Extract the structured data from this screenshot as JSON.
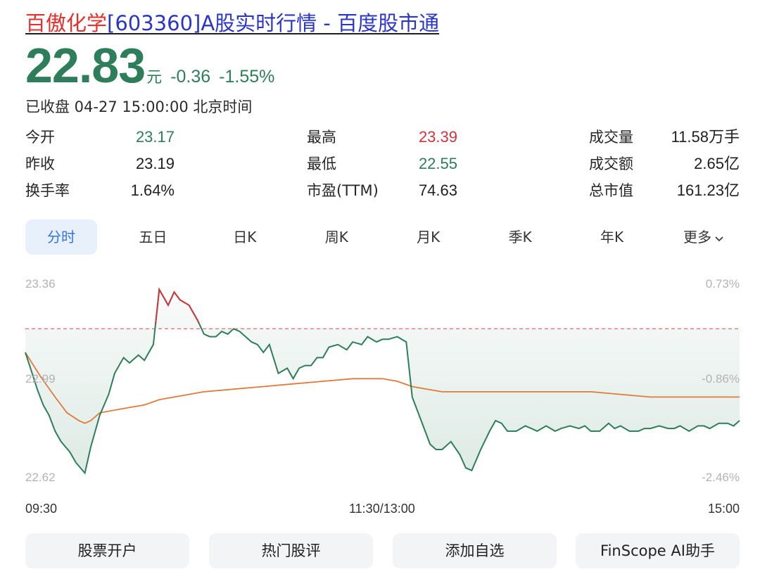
{
  "header": {
    "title_stock": "百傲化学",
    "title_rest": "[603360]A股实时行情 - 百度股市通"
  },
  "quote": {
    "price": "22.83",
    "unit": "元",
    "change": "-0.36",
    "change_pct": "-1.55%",
    "status": "已收盘 04-27 15:00:00 北京时间"
  },
  "stats": [
    {
      "label": "今开",
      "value": "23.17",
      "tone": "green"
    },
    {
      "label": "最高",
      "value": "23.39",
      "tone": "red"
    },
    {
      "label": "成交量",
      "value": "11.58万手",
      "tone": "dark"
    },
    {
      "label": "昨收",
      "value": "23.19",
      "tone": "dark"
    },
    {
      "label": "最低",
      "value": "22.55",
      "tone": "green"
    },
    {
      "label": "成交额",
      "value": "2.65亿",
      "tone": "dark"
    },
    {
      "label": "换手率",
      "value": "1.64%",
      "tone": "dark"
    },
    {
      "label": "市盈(TTM)",
      "value": "74.63",
      "tone": "dark"
    },
    {
      "label": "总市值",
      "value": "161.23亿",
      "tone": "dark"
    }
  ],
  "tabs": [
    "分时",
    "五日",
    "日K",
    "周K",
    "月K",
    "季K",
    "年K",
    "更多"
  ],
  "active_tab": 0,
  "colors": {
    "up": "#d0353f",
    "down": "#2e7d5b",
    "avg": "#e07b39",
    "ref": "#e07070"
  },
  "chart_data": {
    "type": "line",
    "y_axis_left": [
      "23.36",
      "22.99",
      "22.62"
    ],
    "y_axis_right": [
      "0.73%",
      "-0.86%",
      "-2.46%"
    ],
    "x_axis": [
      "09:30",
      "11:30/13:00",
      "15:00"
    ],
    "prev_close": 23.19,
    "ylim": [
      22.62,
      23.36
    ],
    "series": [
      {
        "key": "price",
        "x": [
          0,
          2,
          4,
          6,
          8,
          10,
          12,
          15,
          17,
          20,
          22,
          25,
          28,
          30,
          33,
          35,
          38,
          40,
          43,
          45,
          48,
          50,
          52,
          55,
          58,
          60,
          62,
          64,
          66,
          68,
          70,
          72,
          74,
          76,
          78,
          80,
          82,
          85,
          88,
          90,
          92,
          94,
          96,
          98,
          100,
          102,
          105,
          108,
          110,
          113,
          115,
          118,
          120,
          122,
          125,
          128,
          130,
          133,
          136,
          138,
          140,
          143,
          146,
          148,
          150,
          153,
          156,
          158,
          160,
          162,
          165,
          168,
          170,
          172,
          175,
          178,
          180,
          183,
          186,
          188,
          190,
          193,
          196,
          198,
          200,
          203,
          206,
          208,
          210,
          213,
          216,
          218,
          220,
          223,
          226,
          228,
          230,
          233,
          236,
          238,
          240
        ],
        "values": [
          23.1,
          23.03,
          22.96,
          22.9,
          22.86,
          22.8,
          22.76,
          22.72,
          22.68,
          22.64,
          22.74,
          22.86,
          22.94,
          23.02,
          23.08,
          23.06,
          23.09,
          23.07,
          23.13,
          23.34,
          23.28,
          23.33,
          23.3,
          23.28,
          23.22,
          23.17,
          23.16,
          23.16,
          23.18,
          23.17,
          23.19,
          23.18,
          23.16,
          23.14,
          23.13,
          23.1,
          23.13,
          23.02,
          23.04,
          23.0,
          23.04,
          23.05,
          23.05,
          23.08,
          23.08,
          23.12,
          23.13,
          23.11,
          23.14,
          23.13,
          23.16,
          23.14,
          23.15,
          23.15,
          23.16,
          23.14,
          22.93,
          22.84,
          22.75,
          22.73,
          22.73,
          22.76,
          22.71,
          22.66,
          22.65,
          22.73,
          22.8,
          22.84,
          22.83,
          22.8,
          22.8,
          22.82,
          22.81,
          22.8,
          22.82,
          22.8,
          22.81,
          22.82,
          22.81,
          22.82,
          22.8,
          22.8,
          22.83,
          22.81,
          22.82,
          22.8,
          22.8,
          22.81,
          22.81,
          22.82,
          22.81,
          22.81,
          22.82,
          22.8,
          22.82,
          22.82,
          22.81,
          22.83,
          22.83,
          22.82,
          22.84
        ]
      },
      {
        "key": "average",
        "x": [
          0,
          5,
          10,
          14,
          18,
          20,
          22,
          25,
          30,
          35,
          40,
          45,
          50,
          55,
          60,
          70,
          80,
          90,
          100,
          110,
          115,
          120,
          125,
          130,
          135,
          140,
          150,
          160,
          175,
          190,
          200,
          210,
          220,
          230,
          240
        ],
        "values": [
          23.1,
          23.01,
          22.93,
          22.87,
          22.84,
          22.83,
          22.84,
          22.87,
          22.88,
          22.89,
          22.9,
          22.92,
          22.93,
          22.94,
          22.95,
          22.96,
          22.97,
          22.98,
          22.99,
          23.0,
          23.0,
          23.0,
          22.99,
          22.97,
          22.96,
          22.95,
          22.95,
          22.95,
          22.95,
          22.95,
          22.94,
          22.93,
          22.93,
          22.93,
          22.93
        ]
      }
    ]
  },
  "actions": [
    "股票开户",
    "热门股评",
    "添加自选",
    "FinScope AI助手"
  ]
}
